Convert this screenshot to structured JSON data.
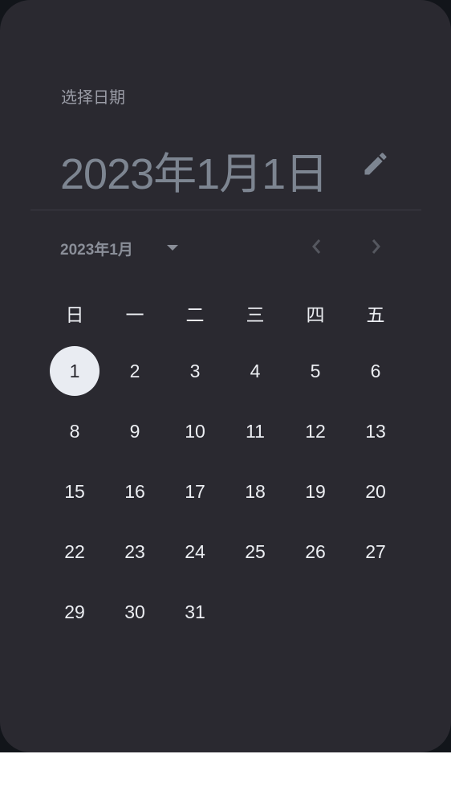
{
  "header": {
    "title": "选择日期",
    "selected_date": "2023年1月1日"
  },
  "nav": {
    "month_label": "2023年1月"
  },
  "weekdays": [
    "日",
    "一",
    "二",
    "三",
    "四",
    "五"
  ],
  "days": [
    [
      "1",
      "2",
      "3",
      "4",
      "5",
      "6"
    ],
    [
      "8",
      "9",
      "10",
      "11",
      "12",
      "13"
    ],
    [
      "15",
      "16",
      "17",
      "18",
      "19",
      "20"
    ],
    [
      "22",
      "23",
      "24",
      "25",
      "26",
      "27"
    ],
    [
      "29",
      "30",
      "31"
    ]
  ],
  "selected_day": "1",
  "colors": {
    "surface": "#2a2930",
    "selected": "#e9ecf2"
  }
}
